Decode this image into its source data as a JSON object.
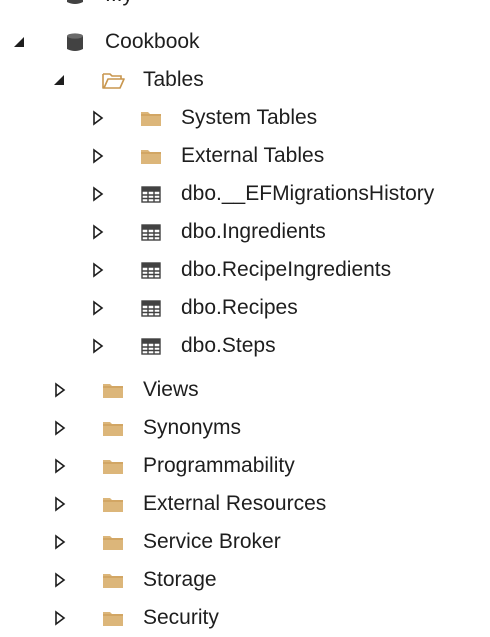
{
  "tree": {
    "partial_top": {
      "label": "...y",
      "icon": "database-icon"
    },
    "database": {
      "label": "Cookbook",
      "icon": "database-icon",
      "expanded": true
    },
    "tables": {
      "label": "Tables",
      "icon": "folder-open-icon",
      "expanded": true
    },
    "table_children": [
      {
        "label": "System Tables",
        "icon": "folder-icon"
      },
      {
        "label": "External Tables",
        "icon": "folder-icon"
      },
      {
        "label": "dbo.__EFMigrationsHistory",
        "icon": "table-icon"
      },
      {
        "label": "dbo.Ingredients",
        "icon": "table-icon"
      },
      {
        "label": "dbo.RecipeIngredients",
        "icon": "table-icon"
      },
      {
        "label": "dbo.Recipes",
        "icon": "table-icon"
      },
      {
        "label": "dbo.Steps",
        "icon": "table-icon"
      }
    ],
    "db_children": [
      {
        "label": "Views",
        "icon": "folder-icon"
      },
      {
        "label": "Synonyms",
        "icon": "folder-icon"
      },
      {
        "label": "Programmability",
        "icon": "folder-icon"
      },
      {
        "label": "External Resources",
        "icon": "folder-icon"
      },
      {
        "label": "Service Broker",
        "icon": "folder-icon"
      },
      {
        "label": "Storage",
        "icon": "folder-icon"
      },
      {
        "label": "Security",
        "icon": "folder-icon"
      }
    ]
  },
  "colors": {
    "folder": "#dcb67a",
    "folder_dark": "#c8964e",
    "database": "#424242",
    "table_grid": "#424242",
    "arrow": "#1e1e1e"
  }
}
